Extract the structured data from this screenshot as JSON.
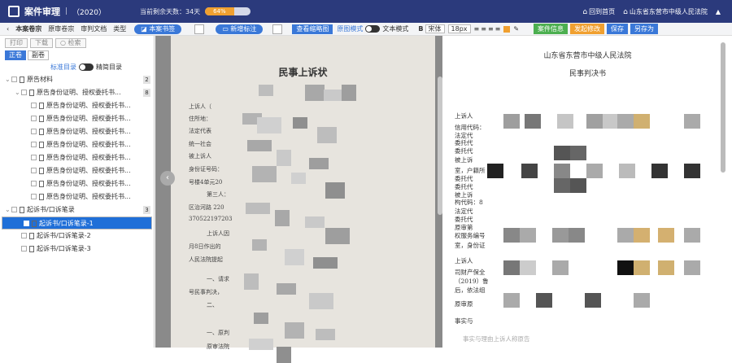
{
  "topbar": {
    "title": "案件审理",
    "case_no": "（2020）",
    "days_left": "当前剩余天数：34天",
    "progress_label": "64%",
    "progress": 0.64,
    "home": "回到首页",
    "court": "山东省东营市中级人民法院"
  },
  "toolbar": {
    "tab1": "本案卷宗",
    "tab2": "原审卷宗",
    "tab3": "审判文档",
    "tab4": "类型",
    "bookmark": "本案书签",
    "mark": "新增标注",
    "thumbnail": "查看缩略图",
    "original": "原图模式",
    "text_mode": "文本模式",
    "font": "宋体",
    "size": "18px",
    "btn_info": "案件信息",
    "btn_edit": "发起修改",
    "btn_save": "保存",
    "btn_saveas": "另存为"
  },
  "left": {
    "btn_print": "打印",
    "btn_download": "下载",
    "btn_check": "检索",
    "tab_pos": "正卷",
    "tab_neg": "副卷",
    "mode1": "标准目录",
    "mode2": "精简目录",
    "tree": [
      {
        "label": "原告材料",
        "count": "2",
        "level": 0
      },
      {
        "label": "原告身份证明、授权委托书...",
        "count": "8",
        "level": 1
      },
      {
        "label": "原告身份证明、授权委托书...",
        "level": 2
      },
      {
        "label": "原告身份证明、授权委托书...",
        "level": 2
      },
      {
        "label": "原告身份证明、授权委托书...",
        "level": 2
      },
      {
        "label": "原告身份证明、授权委托书...",
        "level": 2
      },
      {
        "label": "原告身份证明、授权委托书...",
        "level": 2
      },
      {
        "label": "原告身份证明、授权委托书...",
        "level": 2
      },
      {
        "label": "原告身份证明、授权委托书...",
        "level": 2
      },
      {
        "label": "原告身份证明、授权委托书...",
        "level": 2
      },
      {
        "label": "起诉书/口诉笔录",
        "count": "3",
        "level": 0
      },
      {
        "label": "起诉书/口诉笔录-1",
        "level": 1,
        "selected": true
      },
      {
        "label": "起诉书/口诉笔录-2",
        "level": 1
      },
      {
        "label": "起诉书/口诉笔录-3",
        "level": 1
      }
    ]
  },
  "viewer": {
    "title": "民事上诉状",
    "lines": [
      "上诉人（",
      "住所地：",
      "法定代表",
      "统一社会",
      "被上诉人",
      "身份证号码：",
      "号楼4单元20",
      "第三人：",
      "区治河路 220",
      "370522197203",
      "上诉人因",
      "月8日作出的",
      "人民法院提起",
      "一、请求",
      "号民事判决，",
      "二、",
      "一、原判",
      "原审法院"
    ]
  },
  "rdoc": {
    "court": "山东省东营市中级人民法院",
    "doc": "民事判决书",
    "lines": [
      "上诉人",
      "信用代码：",
      "法定代",
      "委托代",
      "委托代",
      "被上诉",
      "室，户籍所",
      "委托代",
      "委托代",
      "被上诉",
      "构代码：8",
      "法定代",
      "委托代",
      "原审第",
      "权服务编号",
      "室，身份证",
      "上诉人",
      "司财产保全",
      "（2019）鲁",
      "后，依法组",
      "原审原",
      "事实与",
      "事实与理由上诉人称原告"
    ]
  },
  "colors": {
    "topbar": "#2b3a7c",
    "accent": "#3a78d8",
    "green": "#4caf50",
    "orange": "#f0a030"
  }
}
